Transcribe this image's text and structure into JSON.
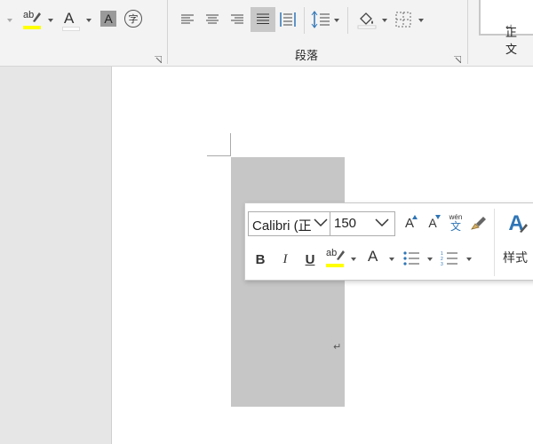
{
  "ribbon": {
    "paragraph_group_label": "段落",
    "char_shading_glyph": "A",
    "font_color_glyph": "A",
    "highlight_glyph": "ab",
    "enclose_char_glyph": "字",
    "style_preview": "正文",
    "style_preview_mark": "↵",
    "colors": {
      "highlight": "#ffff00",
      "font_color": "#ffffff",
      "selected_bg": "#c8c8c8"
    }
  },
  "document": {
    "paragraph_mark": "↵"
  },
  "mini_toolbar": {
    "font_name": "Calibri (正",
    "font_size": "150",
    "grow_font_glyph": "A",
    "shrink_font_glyph": "A",
    "phonetic_top": "wén",
    "phonetic_bottom": "文",
    "bold": "B",
    "italic": "I",
    "underline": "U",
    "highlight_glyph": "ab",
    "font_color_glyph": "A",
    "styles_glyph": "A",
    "styles_label": "样式",
    "colors": {
      "highlight": "#ffff00",
      "font_color": "#ff0000",
      "styles": "#2e75b6"
    }
  }
}
